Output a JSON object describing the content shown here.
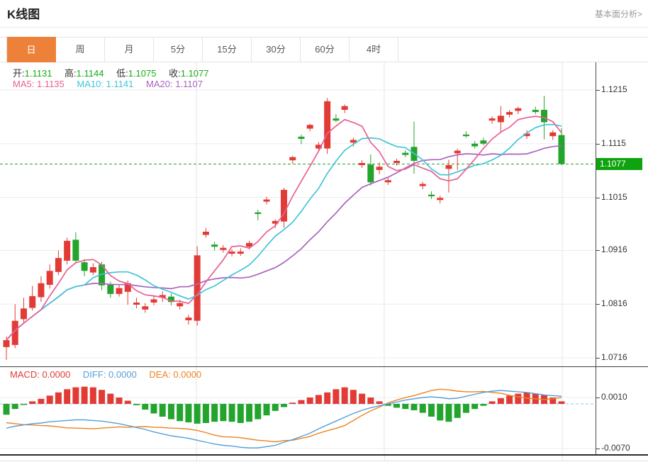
{
  "page": {
    "title": "K线图",
    "link": "基本面分析>"
  },
  "tabs": {
    "items": [
      "日",
      "周",
      "月",
      "5分",
      "15分",
      "30分",
      "60分",
      "4时"
    ],
    "active_index": 0
  },
  "ohlc_legend": {
    "open_label": "开:",
    "open": "1.1131",
    "high_label": "高:",
    "high": "1.1144",
    "low_label": "低:",
    "low": "1.1075",
    "close_label": "收:",
    "close": "1.1077"
  },
  "ma_legend": {
    "ma5_label": "MA5:",
    "ma5": "1.1135",
    "ma10_label": "MA10:",
    "ma10": "1.1141",
    "ma20_label": "MA20:",
    "ma20": "1.1107"
  },
  "macd_legend": {
    "macd_label": "MACD:",
    "macd": "0.0000",
    "diff_label": "DIFF:",
    "diff": "0.0000",
    "dea_label": "DEA:",
    "dea": "0.0000"
  },
  "colors": {
    "up": "#e23b36",
    "down": "#23a42c",
    "badge": "#0fa30f",
    "price_line": "#1fa41f",
    "ma5": "#e85f92",
    "ma10": "#41c5da",
    "ma20": "#ab64bd",
    "diff_line": "#559fd8",
    "dea_line": "#ef821e",
    "tab_accent": "#ee8139",
    "grid": "#ececec",
    "vgrid": "#e6e6e6",
    "axis": "#4a4a4a",
    "macd_zero_line": "#8cc8e8",
    "ohlc_value": "#15ad15"
  },
  "chart_data": {
    "type": "candlestick",
    "title": "K线图 (日)",
    "legend_position": "top-left",
    "grid": true,
    "y_axis": {
      "labels": [
        "1.1215",
        "1.1115",
        "1.1015",
        "1.0916",
        "1.0816",
        "1.0716"
      ],
      "values": [
        1.1215,
        1.1115,
        1.1015,
        1.0916,
        1.0816,
        1.0716
      ],
      "range": [
        1.0716,
        1.1215
      ]
    },
    "price_marker": {
      "label": "1.1077",
      "value": 1.1077
    },
    "ma_periods": [
      5,
      10,
      20
    ],
    "candles": [
      [
        1.0736,
        1.0756,
        1.0712,
        1.0749
      ],
      [
        1.074,
        1.0816,
        1.0734,
        1.0785
      ],
      [
        1.0788,
        1.0828,
        1.0782,
        1.0808
      ],
      [
        1.0809,
        1.085,
        1.0804,
        1.0831
      ],
      [
        1.0829,
        1.0868,
        1.082,
        1.0855
      ],
      [
        1.0852,
        1.089,
        1.0845,
        1.0878
      ],
      [
        1.0876,
        1.0916,
        1.087,
        1.0902
      ],
      [
        1.0897,
        1.094,
        1.089,
        1.0934
      ],
      [
        1.0936,
        1.095,
        1.0892,
        1.0897
      ],
      [
        1.0894,
        1.09,
        1.0868,
        1.0878
      ],
      [
        1.0875,
        1.0892,
        1.087,
        1.0885
      ],
      [
        1.089,
        1.0895,
        1.0842,
        1.0851
      ],
      [
        1.0852,
        1.0858,
        1.0828,
        1.0835
      ],
      [
        1.0835,
        1.0852,
        1.083,
        1.0846
      ],
      [
        1.0839,
        1.086,
        1.0815,
        1.0855
      ],
      [
        1.0815,
        1.0828,
        1.0808,
        1.0819
      ],
      [
        1.0806,
        1.0818,
        1.08,
        1.0812
      ],
      [
        1.0819,
        1.0832,
        1.0814,
        1.0825
      ],
      [
        1.0828,
        1.084,
        1.082,
        1.0833
      ],
      [
        1.083,
        1.0836,
        1.0814,
        1.082
      ],
      [
        1.0812,
        1.0824,
        1.0806,
        1.0818
      ],
      [
        1.0786,
        1.0796,
        1.0778,
        1.0791
      ],
      [
        1.0785,
        1.0924,
        1.0776,
        1.0907
      ],
      [
        1.0945,
        1.0958,
        1.094,
        1.0951
      ],
      [
        1.0927,
        1.0932,
        1.0916,
        1.0923
      ],
      [
        1.0917,
        1.0926,
        1.0912,
        1.0921
      ],
      [
        1.091,
        1.0918,
        1.0905,
        1.0914
      ],
      [
        1.091,
        1.092,
        1.0906,
        1.0914
      ],
      [
        1.0923,
        1.0934,
        1.0918,
        1.093
      ],
      [
        1.0987,
        1.0992,
        1.0972,
        1.0984
      ],
      [
        1.1007,
        1.1016,
        1.1002,
        1.1011
      ],
      [
        1.0966,
        1.0974,
        1.0958,
        1.0971
      ],
      [
        1.097,
        1.1033,
        1.0958,
        1.1029
      ],
      [
        1.1084,
        1.1092,
        1.1078,
        1.109
      ],
      [
        1.1128,
        1.1132,
        1.1114,
        1.1124
      ],
      [
        1.1143,
        1.1152,
        1.1138,
        1.115
      ],
      [
        1.1106,
        1.1118,
        1.11,
        1.1113
      ],
      [
        1.1106,
        1.12,
        1.1096,
        1.1194
      ],
      [
        1.1162,
        1.117,
        1.1155,
        1.1158
      ],
      [
        1.1178,
        1.1188,
        1.1172,
        1.1185
      ],
      [
        1.1117,
        1.1126,
        1.111,
        1.1122
      ],
      [
        1.1075,
        1.1084,
        1.107,
        1.1079
      ],
      [
        1.1076,
        1.1095,
        1.1037,
        1.1043
      ],
      [
        1.1066,
        1.108,
        1.1058,
        1.1072
      ],
      [
        1.1043,
        1.1052,
        1.1038,
        1.1047
      ],
      [
        1.1079,
        1.1087,
        1.1074,
        1.1083
      ],
      [
        1.1098,
        1.1103,
        1.109,
        1.1094
      ],
      [
        1.1109,
        1.1156,
        1.1059,
        1.1083
      ],
      [
        1.1036,
        1.1044,
        1.103,
        1.104
      ],
      [
        1.102,
        1.1026,
        1.1012,
        1.1017
      ],
      [
        1.101,
        1.1018,
        1.1004,
        1.1014
      ],
      [
        1.1068,
        1.1085,
        1.1024,
        1.1075
      ],
      [
        1.1097,
        1.1106,
        1.1066,
        1.1102
      ],
      [
        1.1132,
        1.1138,
        1.1126,
        1.1129
      ],
      [
        1.1115,
        1.112,
        1.1106,
        1.111
      ],
      [
        1.1121,
        1.1126,
        1.1112,
        1.1115
      ],
      [
        1.1158,
        1.1166,
        1.1152,
        1.1162
      ],
      [
        1.1155,
        1.1185,
        1.1135,
        1.1167
      ],
      [
        1.1169,
        1.1178,
        1.1164,
        1.1174
      ],
      [
        1.1176,
        1.1184,
        1.117,
        1.1181
      ],
      [
        1.1129,
        1.114,
        1.1124,
        1.1134
      ],
      [
        1.1178,
        1.1184,
        1.117,
        1.1174
      ],
      [
        1.1178,
        1.1204,
        1.1123,
        1.1155
      ],
      [
        1.1129,
        1.114,
        1.1122,
        1.1136
      ],
      [
        1.1131,
        1.1144,
        1.1075,
        1.1077
      ]
    ],
    "macd": {
      "axis_labels": [
        "0.0010",
        "-0.0070"
      ],
      "axis_values": [
        0.001,
        -0.007
      ],
      "hist": [
        -0.0017,
        -0.0008,
        -0.0001,
        0.0004,
        0.0008,
        0.0013,
        0.0018,
        0.0023,
        0.0026,
        0.0027,
        0.0026,
        0.0022,
        0.0016,
        0.001,
        0.0005,
        -0.0002,
        -0.0009,
        -0.0015,
        -0.002,
        -0.0024,
        -0.0027,
        -0.0029,
        -0.0031,
        -0.003,
        -0.0028,
        -0.0027,
        -0.0028,
        -0.003,
        -0.0028,
        -0.0024,
        -0.0018,
        -0.0011,
        -0.0005,
        0.0002,
        0.0006,
        0.001,
        0.0014,
        0.0018,
        0.0023,
        0.0026,
        0.0022,
        0.0016,
        0.001,
        0.0004,
        -0.0003,
        -0.0006,
        -0.0008,
        -0.001,
        -0.0014,
        -0.002,
        -0.0026,
        -0.0028,
        -0.0022,
        -0.0014,
        -0.0008,
        -0.0003,
        0.0004,
        0.0009,
        0.0013,
        0.0016,
        0.0018,
        0.0016,
        0.0014,
        0.001,
        0.0004
      ],
      "diff": [
        -0.0038,
        -0.0035,
        -0.0033,
        -0.0031,
        -0.003,
        -0.0028,
        -0.0027,
        -0.0026,
        -0.0025,
        -0.0025,
        -0.0026,
        -0.0027,
        -0.0029,
        -0.0031,
        -0.0034,
        -0.0037,
        -0.004,
        -0.0044,
        -0.0047,
        -0.005,
        -0.0052,
        -0.0054,
        -0.0057,
        -0.006,
        -0.0063,
        -0.0065,
        -0.0066,
        -0.0068,
        -0.0069,
        -0.0069,
        -0.0067,
        -0.0065,
        -0.006,
        -0.0056,
        -0.0051,
        -0.0046,
        -0.0039,
        -0.0033,
        -0.0027,
        -0.0021,
        -0.0015,
        -0.001,
        -0.0006,
        -0.0003,
        0.0,
        0.0003,
        0.0006,
        0.0008,
        0.001,
        0.0011,
        0.001,
        0.0008,
        0.0009,
        0.0012,
        0.0015,
        0.0018,
        0.002,
        0.0021,
        0.002,
        0.0019,
        0.0018,
        0.0016,
        0.0014,
        0.0013,
        0.0012
      ]
    }
  }
}
